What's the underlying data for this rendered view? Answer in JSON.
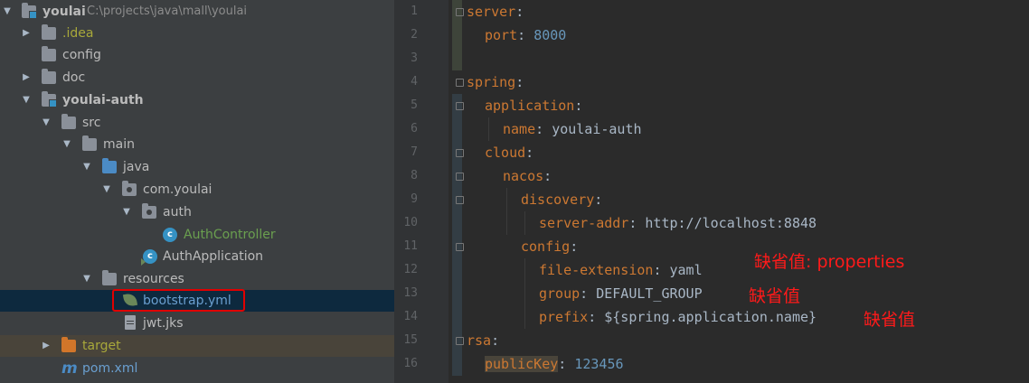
{
  "project_tree": {
    "root": {
      "name": "youlai",
      "path": "C:\\projects\\java\\mall\\youlai"
    },
    "idea": ".idea",
    "config": "config",
    "doc": "doc",
    "module": "youlai-auth",
    "src": "src",
    "main": "main",
    "java": "java",
    "package": "com.youlai",
    "subpackage": "auth",
    "controller": "AuthController",
    "application": "AuthApplication",
    "resources": "resources",
    "selected_file": "bootstrap.yml",
    "jks_file": "jwt.jks",
    "target": "target",
    "pom": "pom.xml"
  },
  "editor": {
    "line_numbers": [
      "1",
      "2",
      "3",
      "4",
      "5",
      "6",
      "7",
      "8",
      "9",
      "10",
      "11",
      "12",
      "13",
      "14",
      "15",
      "16"
    ],
    "lines": [
      {
        "key": "server",
        "sep": ":"
      },
      {
        "key": "port",
        "sep": ": ",
        "value": "8000"
      },
      {},
      {
        "key": "spring",
        "sep": ":"
      },
      {
        "key": "application",
        "sep": ":"
      },
      {
        "key": "name",
        "sep": ": ",
        "value": "youlai-auth"
      },
      {
        "key": "cloud",
        "sep": ":"
      },
      {
        "key": "nacos",
        "sep": ":"
      },
      {
        "key": "discovery",
        "sep": ":"
      },
      {
        "key": "server-addr",
        "sep": ": ",
        "value": "http://localhost:8848"
      },
      {
        "key": "config",
        "sep": ":"
      },
      {
        "key": "file-extension",
        "sep": ": ",
        "value": "yaml"
      },
      {
        "key": "group",
        "sep": ": ",
        "value": "DEFAULT_GROUP"
      },
      {
        "key": "prefix",
        "sep": ": ",
        "value": "${spring.application.name}"
      },
      {
        "key": "rsa",
        "sep": ":"
      },
      {
        "key": "publicKey",
        "sep": ": ",
        "value": "123456"
      }
    ]
  },
  "annotations": {
    "file_extension": "缺省值: properties",
    "group": "缺省值",
    "prefix": "缺省值"
  },
  "colors": {
    "annotation": "#ff1a1a",
    "highlight_box": "#e00000",
    "yaml_key": "#cc7832",
    "number": "#6897bb"
  }
}
